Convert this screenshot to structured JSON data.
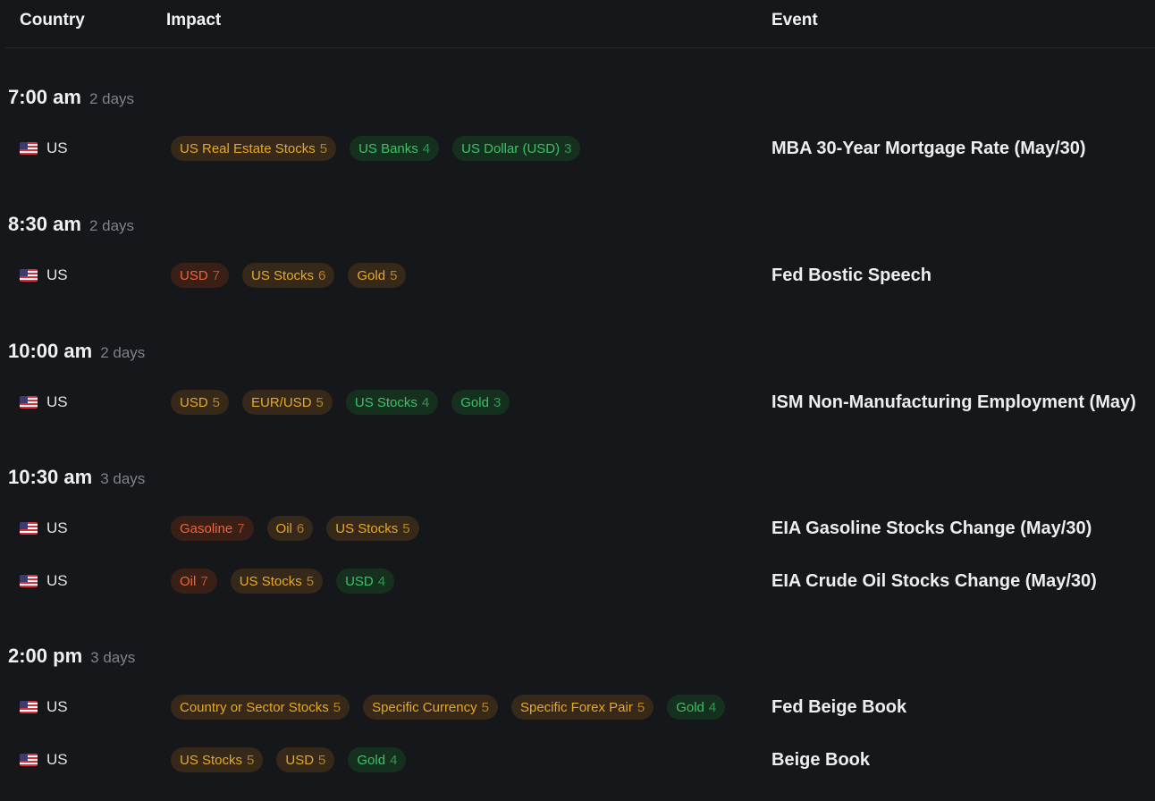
{
  "header": {
    "country": "Country",
    "impact": "Impact",
    "event": "Event"
  },
  "colors": {
    "background": "#15171b",
    "high": "#f06435",
    "medium": "#e6a827",
    "low": "#3cc266"
  },
  "groups": [
    {
      "time": "7:00 am",
      "days": "2 days",
      "rows": [
        {
          "country": "US",
          "flag": "us-flag-icon",
          "event": "MBA 30-Year Mortgage Rate (May/30)",
          "impacts": [
            {
              "label": "US Real Estate Stocks",
              "score": "5",
              "level": "med"
            },
            {
              "label": "US Banks",
              "score": "4",
              "level": "low"
            },
            {
              "label": "US Dollar (USD)",
              "score": "3",
              "level": "low"
            }
          ]
        }
      ]
    },
    {
      "time": "8:30 am",
      "days": "2 days",
      "rows": [
        {
          "country": "US",
          "flag": "us-flag-icon",
          "event": "Fed Bostic Speech",
          "impacts": [
            {
              "label": "USD",
              "score": "7",
              "level": "high"
            },
            {
              "label": "US Stocks",
              "score": "6",
              "level": "med"
            },
            {
              "label": "Gold",
              "score": "5",
              "level": "med"
            }
          ]
        }
      ]
    },
    {
      "time": "10:00 am",
      "days": "2 days",
      "rows": [
        {
          "country": "US",
          "flag": "us-flag-icon",
          "event": "ISM Non-Manufacturing Employment (May)",
          "impacts": [
            {
              "label": "USD",
              "score": "5",
              "level": "med"
            },
            {
              "label": "EUR/USD",
              "score": "5",
              "level": "med"
            },
            {
              "label": "US Stocks",
              "score": "4",
              "level": "low"
            },
            {
              "label": "Gold",
              "score": "3",
              "level": "low"
            }
          ]
        }
      ]
    },
    {
      "time": "10:30 am",
      "days": "3 days",
      "rows": [
        {
          "country": "US",
          "flag": "us-flag-icon",
          "event": "EIA Gasoline Stocks Change (May/30)",
          "impacts": [
            {
              "label": "Gasoline",
              "score": "7",
              "level": "high"
            },
            {
              "label": "Oil",
              "score": "6",
              "level": "med"
            },
            {
              "label": "US Stocks",
              "score": "5",
              "level": "med"
            }
          ]
        },
        {
          "country": "US",
          "flag": "us-flag-icon",
          "event": "EIA Crude Oil Stocks Change (May/30)",
          "impacts": [
            {
              "label": "Oil",
              "score": "7",
              "level": "high"
            },
            {
              "label": "US Stocks",
              "score": "5",
              "level": "med"
            },
            {
              "label": "USD",
              "score": "4",
              "level": "low"
            }
          ]
        }
      ]
    },
    {
      "time": "2:00 pm",
      "days": "3 days",
      "rows": [
        {
          "country": "US",
          "flag": "us-flag-icon",
          "event": "Fed Beige Book",
          "impacts": [
            {
              "label": "Country or Sector Stocks",
              "score": "5",
              "level": "med"
            },
            {
              "label": "Specific Currency",
              "score": "5",
              "level": "med"
            },
            {
              "label": "Specific Forex Pair",
              "score": "5",
              "level": "med"
            },
            {
              "label": "Gold",
              "score": "4",
              "level": "low"
            }
          ]
        },
        {
          "country": "US",
          "flag": "us-flag-icon",
          "event": "Beige Book",
          "impacts": [
            {
              "label": "US Stocks",
              "score": "5",
              "level": "med"
            },
            {
              "label": "USD",
              "score": "5",
              "level": "med"
            },
            {
              "label": "Gold",
              "score": "4",
              "level": "low"
            }
          ]
        }
      ]
    }
  ]
}
